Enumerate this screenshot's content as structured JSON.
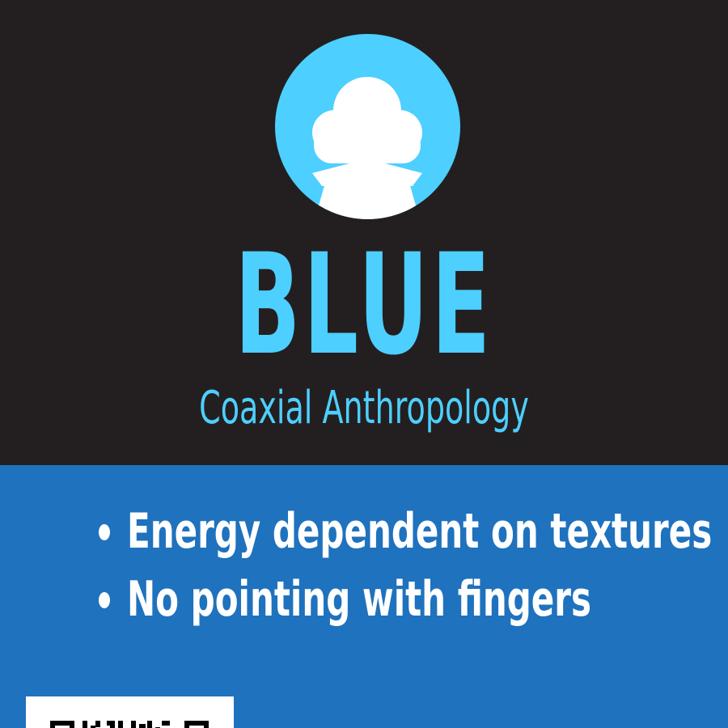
{
  "card": {
    "title": "BLUE",
    "subtitle": "Coaxial Anthropology",
    "traits": [
      "Energy dependent on textures",
      "No pointing with fingers"
    ]
  },
  "icons": {
    "avatar": "character-silhouette-icon",
    "qr": "qr-code-icon"
  },
  "colors": {
    "top_background": "#231f20",
    "accent": "#4dcfff",
    "bottom_background": "#1f72bd",
    "text_light": "#ffffff"
  }
}
